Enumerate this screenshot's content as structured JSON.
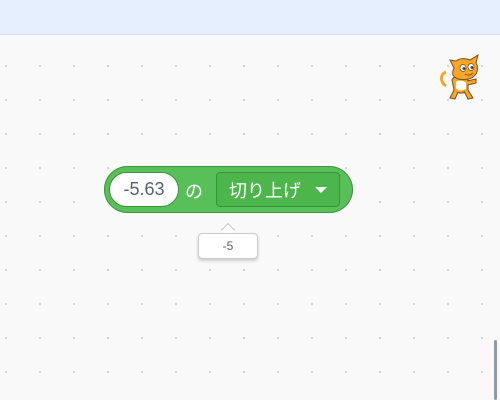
{
  "block": {
    "input_value": "-5.63",
    "of_label": "の",
    "operator_label": "切り上げ"
  },
  "report": {
    "value": "-5"
  },
  "icons": {
    "sprite": "scratch-cat-icon",
    "dropdown": "caret-down-icon"
  },
  "colors": {
    "block_fill": "#59c059",
    "block_border": "#389438",
    "topbar": "#e5effd",
    "workspace": "#f9f9f9"
  }
}
